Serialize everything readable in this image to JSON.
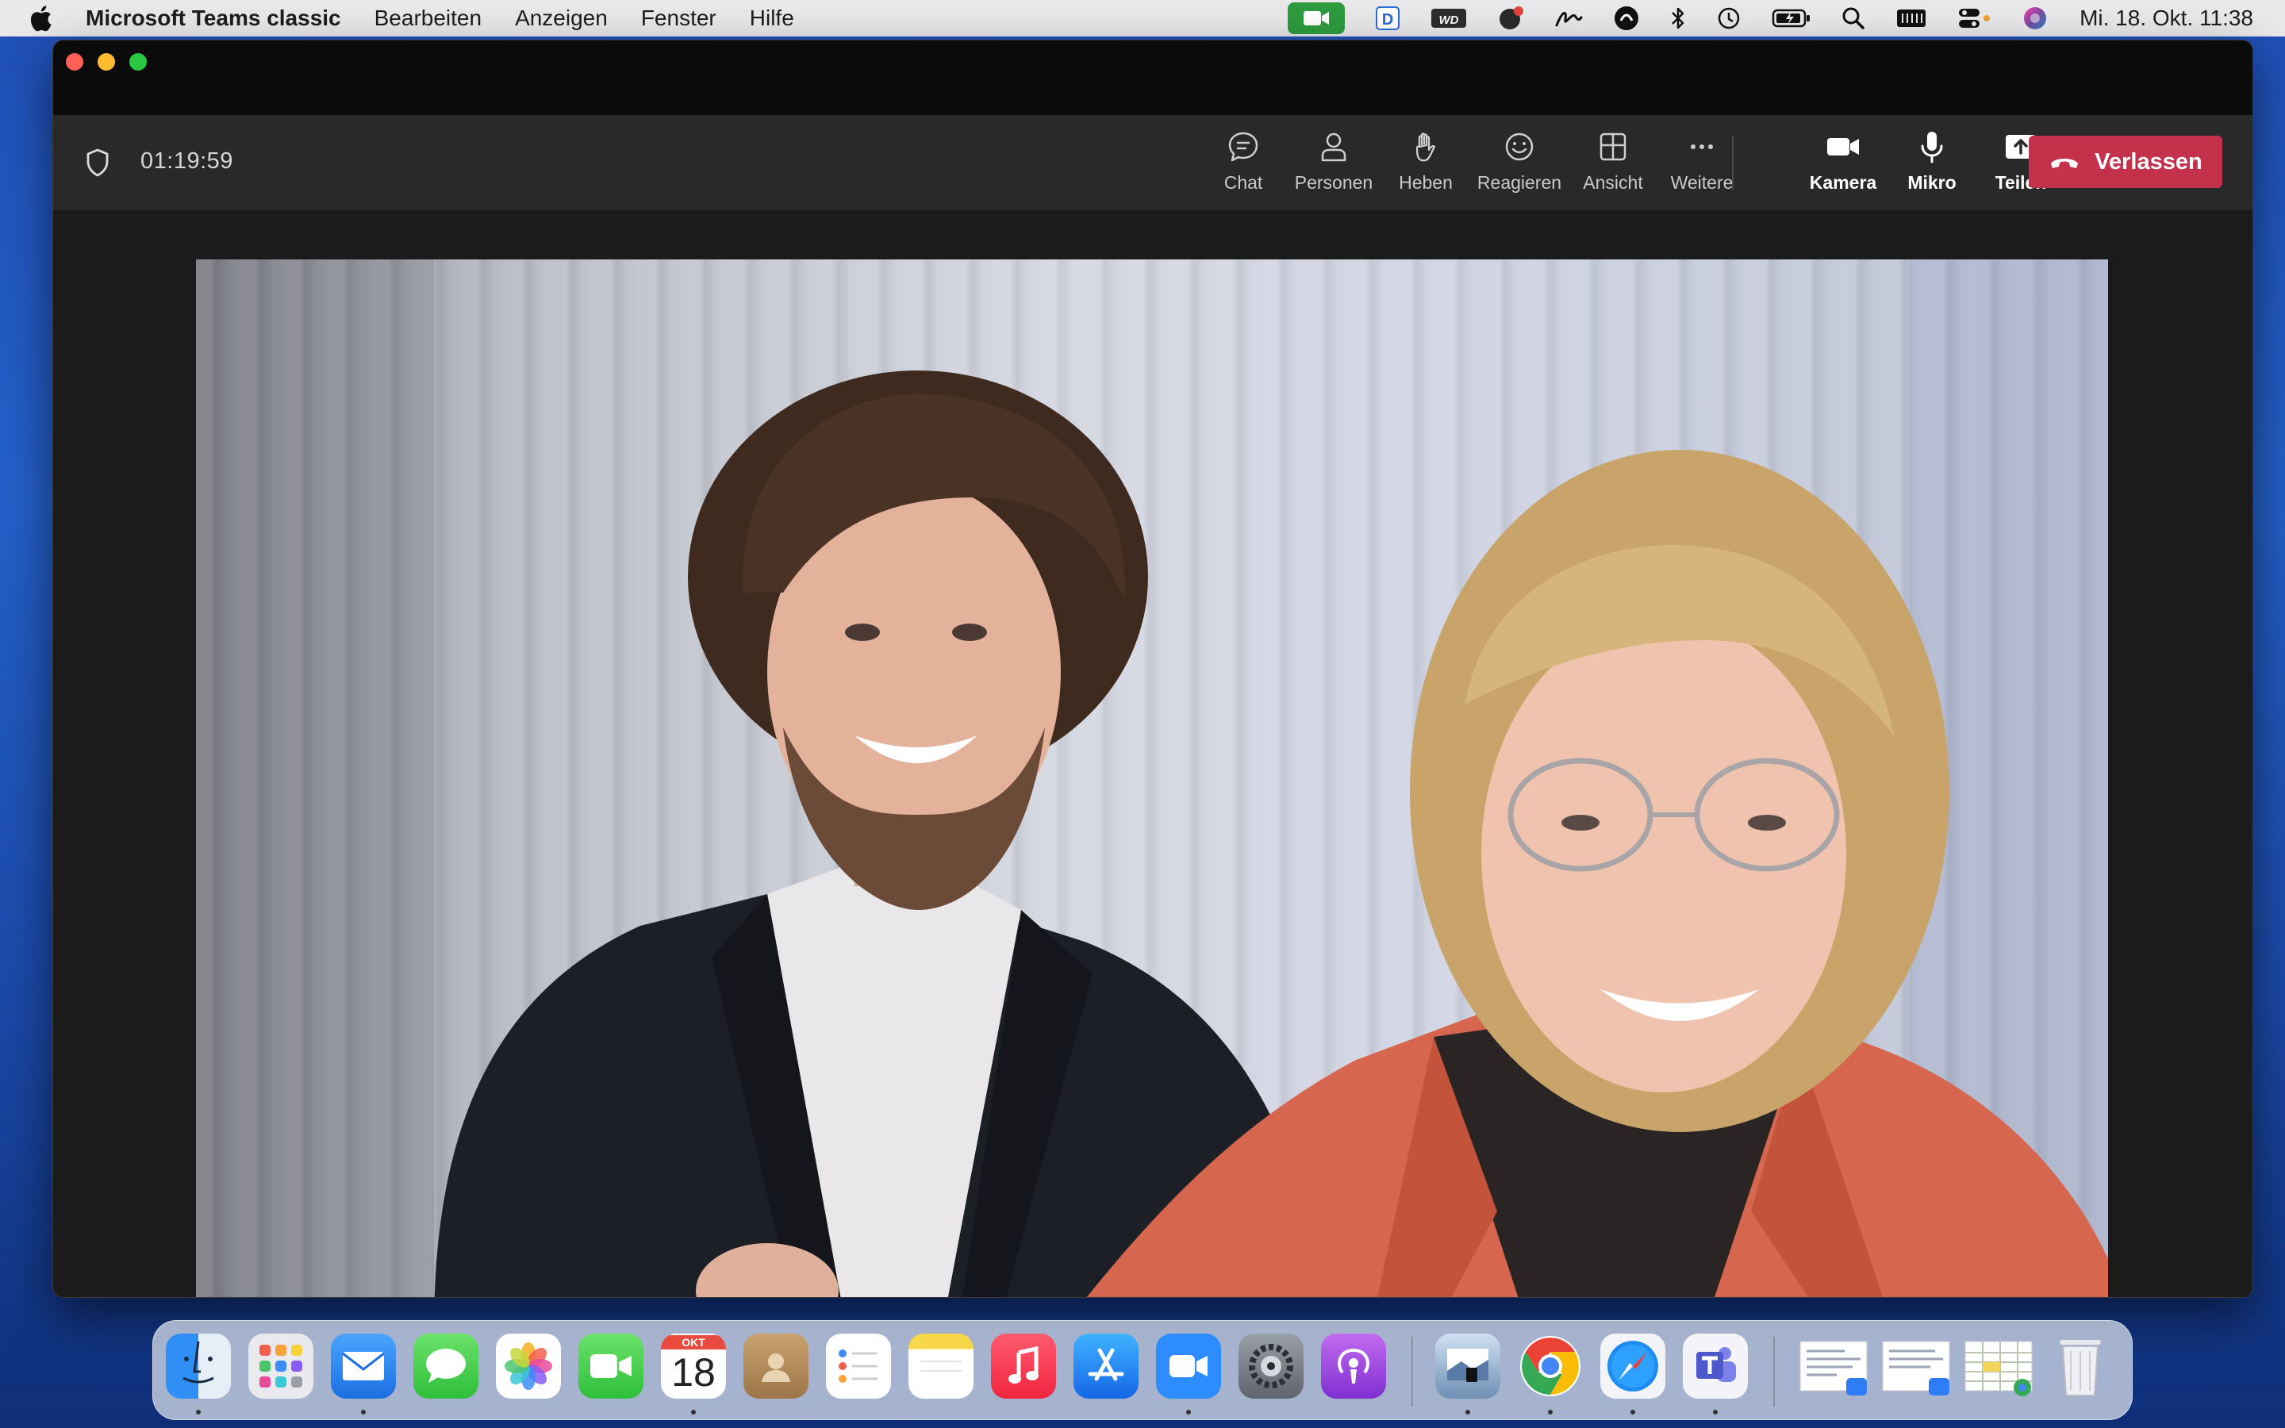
{
  "menubar": {
    "app_name": "Microsoft Teams classic",
    "menus": [
      "Bearbeiten",
      "Anzeigen",
      "Fenster",
      "Hilfe"
    ],
    "clock": "Mi. 18. Okt. 11:38",
    "status_icons": [
      "camera-in-use-icon",
      "dictionary-icon",
      "wd-icon",
      "notification-icon",
      "signature-icon",
      "vpn-icon",
      "bluetooth-icon",
      "time-machine-icon",
      "battery-icon",
      "spotlight-icon",
      "keyboard-icon",
      "control-center-icon",
      "siri-icon"
    ]
  },
  "meeting": {
    "timer": "01:19:59",
    "controls": {
      "chat": "Chat",
      "people": "Personen",
      "raise_hand": "Heben",
      "react": "Reagieren",
      "view": "Ansicht",
      "more": "Weitere",
      "camera": "Kamera",
      "mic": "Mikro",
      "share": "Teilen"
    },
    "leave_label": "Verlassen"
  },
  "dock": {
    "calendar_month": "OKT",
    "calendar_day": "18",
    "apps": [
      "finder",
      "launchpad",
      "mail",
      "messages",
      "photos",
      "facetime",
      "calendar",
      "contacts",
      "reminders",
      "notes",
      "music",
      "app-store",
      "zoom",
      "system-settings",
      "podcasts",
      "preview",
      "chrome",
      "safari",
      "teams",
      "document-1",
      "document-2",
      "spreadsheet",
      "trash"
    ]
  },
  "colors": {
    "leave_button": "#c4314b",
    "camera_badge": "#2e9b3e",
    "toolbar_bg": "#292929"
  }
}
